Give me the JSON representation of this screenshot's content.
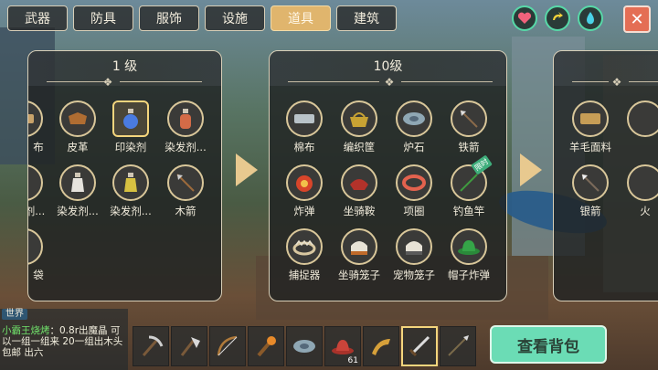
{
  "tabs": [
    "武器",
    "防具",
    "服饰",
    "设施",
    "道具",
    "建筑"
  ],
  "active_tab": "道具",
  "colors": {
    "accent": "#e0b56d",
    "panel_border": "#d8cfb8",
    "bag_button": "#6bdcb5",
    "close": "#e46e54"
  },
  "panels": [
    {
      "title": "1 级",
      "items": [
        "布",
        "皮革",
        "印染剂",
        "染发剂...",
        "剂...",
        "染发剂...",
        "染发剂...",
        "木箭",
        "袋"
      ]
    },
    {
      "title": "10级",
      "items": [
        "棉布",
        "编织筐",
        "炉石",
        "铁箭",
        "炸弹",
        "坐骑鞍",
        "项圈",
        "钓鱼竿",
        "捕捉器",
        "坐骑笼子",
        "宠物笼子",
        "帽子炸弹"
      ],
      "new_tag": "限时"
    },
    {
      "title": "",
      "items": [
        "羊毛面料",
        "",
        "银箭",
        "火"
      ]
    }
  ],
  "chat": {
    "channel": "世界",
    "name": "小霸王烧烤",
    "text": "：0.8r出魔晶 可以一组一组来 20一组出木头包邮 出六"
  },
  "hotbar": {
    "count": "61"
  },
  "bag_button": "查看背包",
  "icons": {
    "heart": "heart-icon",
    "arrow": "yellow-swirl-icon",
    "drop": "water-drop-icon",
    "close": "close-icon"
  }
}
